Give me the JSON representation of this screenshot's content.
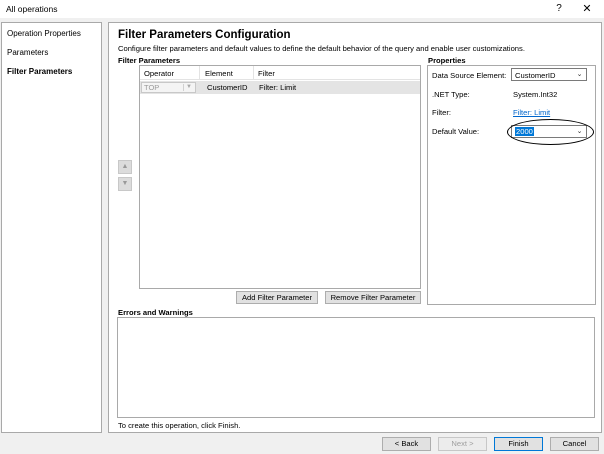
{
  "window": {
    "title": "All operations",
    "help_glyph": "?",
    "close_glyph": "✕"
  },
  "nav": {
    "items": [
      {
        "label": "Operation Properties"
      },
      {
        "label": "Parameters"
      },
      {
        "label": "Filter Parameters"
      }
    ]
  },
  "main": {
    "title": "Filter Parameters Configuration",
    "description": "Configure filter parameters and default values to define the default behavior of the query and enable user customizations.",
    "filter_section_label": "Filter Parameters",
    "grid": {
      "headers": [
        "Operator",
        "Element",
        "Filter"
      ],
      "rows": [
        {
          "operator": "TOP",
          "element": "CustomerID",
          "filter": "Filter: Limit"
        }
      ]
    },
    "move_up_glyph": "▲",
    "move_down_glyph": "▼",
    "add_filter_label": "Add Filter Parameter",
    "remove_filter_label": "Remove Filter Parameter",
    "properties": {
      "section_label": "Properties",
      "data_source_label": "Data Source Element:",
      "data_source_value": "CustomerID",
      "net_type_label": ".NET Type:",
      "net_type_value": "System.Int32",
      "filter_label": "Filter:",
      "filter_link": "Filter: Limit",
      "default_value_label": "Default Value:",
      "default_value": "2000"
    },
    "errors_label": "Errors and Warnings",
    "status_text": "To create this operation, click Finish."
  },
  "footer": {
    "back_label": "< Back",
    "next_label": "Next >",
    "finish_label": "Finish",
    "cancel_label": "Cancel"
  }
}
